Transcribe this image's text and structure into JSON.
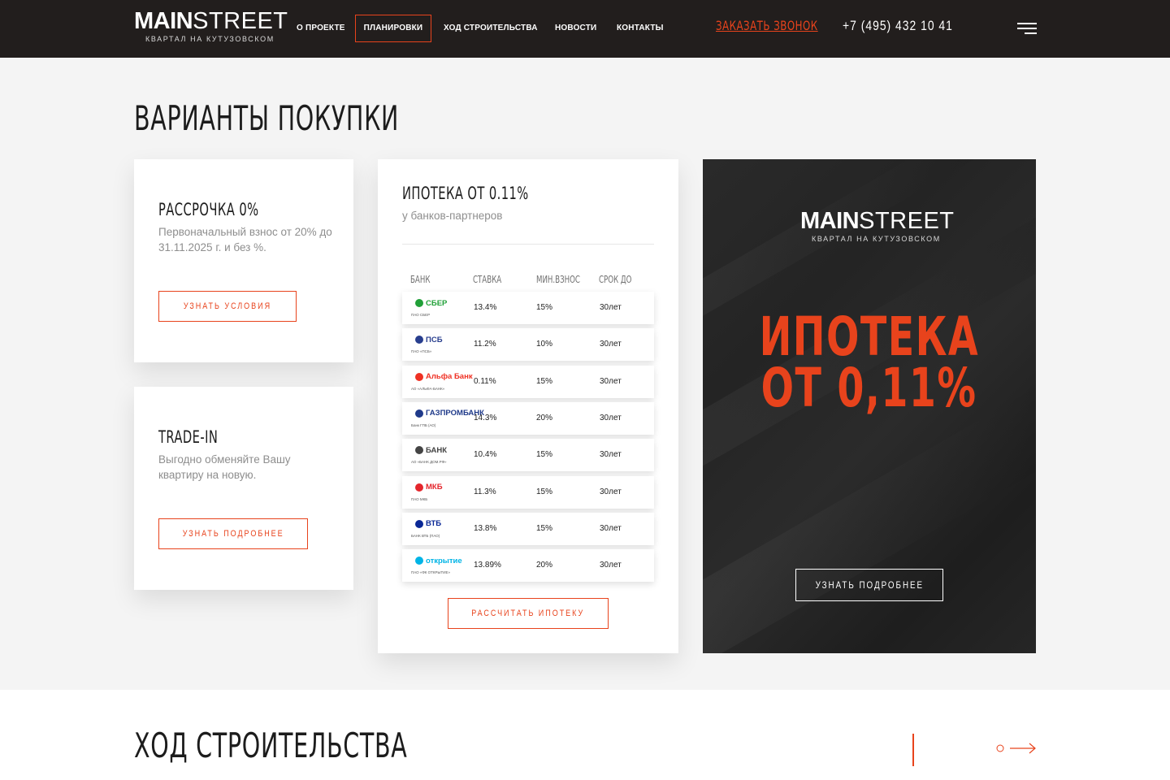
{
  "header": {
    "logo_bold": "MAIN",
    "logo_light": "STREET",
    "logo_sub": "КВАРТАЛ НА КУТУЗОВСКОМ",
    "nav": [
      "О ПРОЕКТЕ",
      "ПЛАНИРОВКИ",
      "ХОД СТРОИТЕЛЬСТВА",
      "НОВОСТИ",
      "КОНТАКТЫ"
    ],
    "active_nav": "ПЛАНИРОВКИ",
    "callback": "ЗАКАЗАТЬ ЗВОНОК",
    "phone": "+7 (495) 432 10 41"
  },
  "section": {
    "title": "ВАРИАНТЫ ПОКУПКИ",
    "next_title": "ХОД СТРОИТЕЛЬСТВА"
  },
  "installment": {
    "title": "РАССРОЧКА 0%",
    "text": "Первоначальный взнос от 20% до 31.11.2025 г. и без %.",
    "button": "УЗНАТЬ УСЛОВИЯ"
  },
  "tradein": {
    "title": "TRADE-IN",
    "text": "Выгодно обменяйте Вашу квартиру на новую.",
    "button": "УЗНАТЬ ПОДРОБНЕЕ"
  },
  "mortgage": {
    "title": "ИПОТЕКА ОТ 0.11%",
    "subtitle": "у банков-партнеров",
    "columns": [
      "БАНК",
      "СТАВКА",
      "МИН.ВЗНОС",
      "СРОК ДО"
    ],
    "rows": [
      {
        "bank": "СБЕР",
        "legal": "ПАО СБЕР",
        "rate": "13.4%",
        "min": "15%",
        "term": "30лет",
        "color": "#21a038"
      },
      {
        "bank": "ПСБ",
        "legal": "ПАО «ПСБ»",
        "rate": "11.2%",
        "min": "10%",
        "term": "30лет",
        "color": "#283e8e"
      },
      {
        "bank": "Альфа Банк",
        "legal": "АО «АЛЬФА-БАНК»",
        "rate": "0.11%",
        "min": "15%",
        "term": "30лет",
        "color": "#ef3124"
      },
      {
        "bank": "ГАЗПРОМБАНК",
        "legal": "Банк ГПБ (АО)",
        "rate": "14.3%",
        "min": "20%",
        "term": "30лет",
        "color": "#1f3a8a"
      },
      {
        "bank": "БАНК",
        "legal": "АО «БАНК ДОМ.РФ»",
        "rate": "10.4%",
        "min": "15%",
        "term": "30лет",
        "color": "#444444"
      },
      {
        "bank": "МКБ",
        "legal": "ПАО МКБ",
        "rate": "11.3%",
        "min": "15%",
        "term": "30лет",
        "color": "#e4262c"
      },
      {
        "bank": "ВТБ",
        "legal": "БАНК ВТБ (ПАО)",
        "rate": "13.8%",
        "min": "15%",
        "term": "30лет",
        "color": "#0a2896"
      },
      {
        "bank": "открытие",
        "legal": "ПАО «ФК ОТКРЫТИЕ»",
        "rate": "13.89%",
        "min": "20%",
        "term": "30лет",
        "color": "#00b4e6"
      }
    ],
    "button": "РАССЧИТАТЬ ИПОТЕКУ"
  },
  "promo": {
    "line1": "ИПОТЕКА",
    "line2": "ОТ 0,11%",
    "button": "УЗНАТЬ ПОДРОБНЕЕ"
  },
  "colors": {
    "accent": "#e8431c",
    "header_bg": "#221e1d",
    "page_bg": "#f4f4f4",
    "promo_bg": "#262626"
  }
}
